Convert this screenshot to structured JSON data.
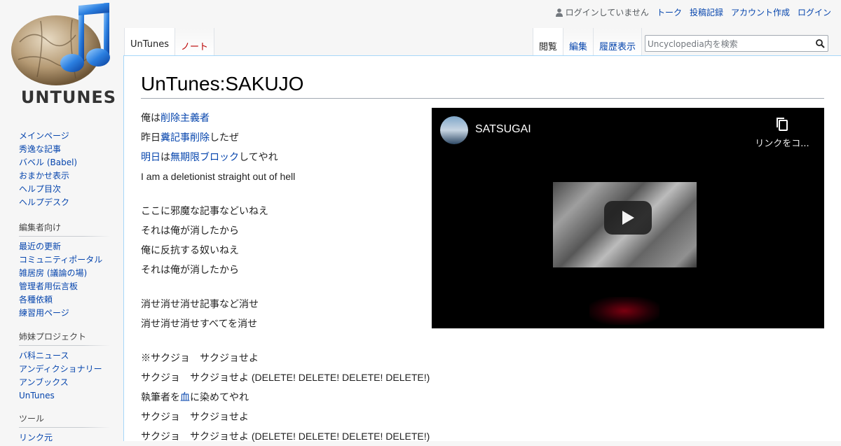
{
  "logo": {
    "text": "UNTUNES"
  },
  "personal": {
    "not_logged_in": "ログインしていません",
    "talk": "トーク",
    "contributions": "投稿記録",
    "create_account": "アカウント作成",
    "login": "ログイン"
  },
  "tabs": {
    "left": [
      {
        "label": "UnTunes",
        "state": "selected"
      },
      {
        "label": "ノート",
        "state": "new"
      }
    ],
    "right": [
      {
        "label": "閲覧",
        "state": "selected"
      },
      {
        "label": "編集",
        "state": "link"
      },
      {
        "label": "履歴表示",
        "state": "link"
      }
    ]
  },
  "search": {
    "placeholder": "Uncyclopedia内を検索"
  },
  "page": {
    "title": "UnTunes:SAKUJO"
  },
  "lyrics": [
    {
      "segments": [
        {
          "t": "俺は"
        },
        {
          "t": "削除主義者",
          "link": true
        }
      ]
    },
    {
      "segments": [
        {
          "t": "昨日"
        },
        {
          "t": "糞記事",
          "link": true
        },
        {
          "t": "削除",
          "link": true
        },
        {
          "t": "したぜ"
        }
      ]
    },
    {
      "segments": [
        {
          "t": "明日",
          "link": true
        },
        {
          "t": "は"
        },
        {
          "t": "無期限ブロック",
          "link": true
        },
        {
          "t": "してやれ"
        }
      ]
    },
    {
      "segments": [
        {
          "t": "I am a deletionist straight out of hell"
        }
      ]
    },
    {
      "gap": true
    },
    {
      "segments": [
        {
          "t": "ここに邪魔な記事などいねえ"
        }
      ]
    },
    {
      "segments": [
        {
          "t": "それは俺が消したから"
        }
      ]
    },
    {
      "segments": [
        {
          "t": "俺に反抗する奴いねえ"
        }
      ]
    },
    {
      "segments": [
        {
          "t": "それは俺が消したから"
        }
      ]
    },
    {
      "gap": true
    },
    {
      "segments": [
        {
          "t": "消せ消せ消せ記事など消せ"
        }
      ]
    },
    {
      "segments": [
        {
          "t": "消せ消せ消せすべてを消せ"
        }
      ]
    },
    {
      "gap": true
    },
    {
      "segments": [
        {
          "t": "※サクジョ　サクジョせよ"
        }
      ]
    },
    {
      "segments": [
        {
          "t": "サクジョ　サクジョせよ (DELETE! DELETE! DELETE! DELETE!)"
        }
      ]
    },
    {
      "segments": [
        {
          "t": "執筆者を"
        },
        {
          "t": "血",
          "link": true
        },
        {
          "t": "に染めてやれ"
        }
      ]
    },
    {
      "segments": [
        {
          "t": "サクジョ　サクジョせよ"
        }
      ]
    },
    {
      "segments": [
        {
          "t": "サクジョ　サクジョせよ (DELETE! DELETE! DELETE! DELETE!)"
        }
      ]
    }
  ],
  "video": {
    "title": "SATSUGAI",
    "copy_label": "リンクをコ..."
  },
  "sidebar": {
    "navigation": {
      "items": [
        "メインページ",
        "秀逸な記事",
        "バベル (Babel)",
        "おまかせ表示",
        "ヘルプ目次",
        "ヘルプデスク"
      ]
    },
    "editors": {
      "heading": "編集者向け",
      "items": [
        "最近の更新",
        "コミュニティポータル",
        "雑居房 (議論の場)",
        "管理者用伝言板",
        "各種依頼",
        "練習用ページ"
      ]
    },
    "sister": {
      "heading": "姉妹プロジェクト",
      "items": [
        "バ科ニュース",
        "アンディクショナリー",
        "アンブックス",
        "UnTunes"
      ]
    },
    "tools": {
      "heading": "ツール",
      "items": [
        "リンク元"
      ]
    }
  },
  "colors": {
    "link": "#0645ad",
    "new_link": "#ba0000",
    "border": "#a7d7f9"
  }
}
